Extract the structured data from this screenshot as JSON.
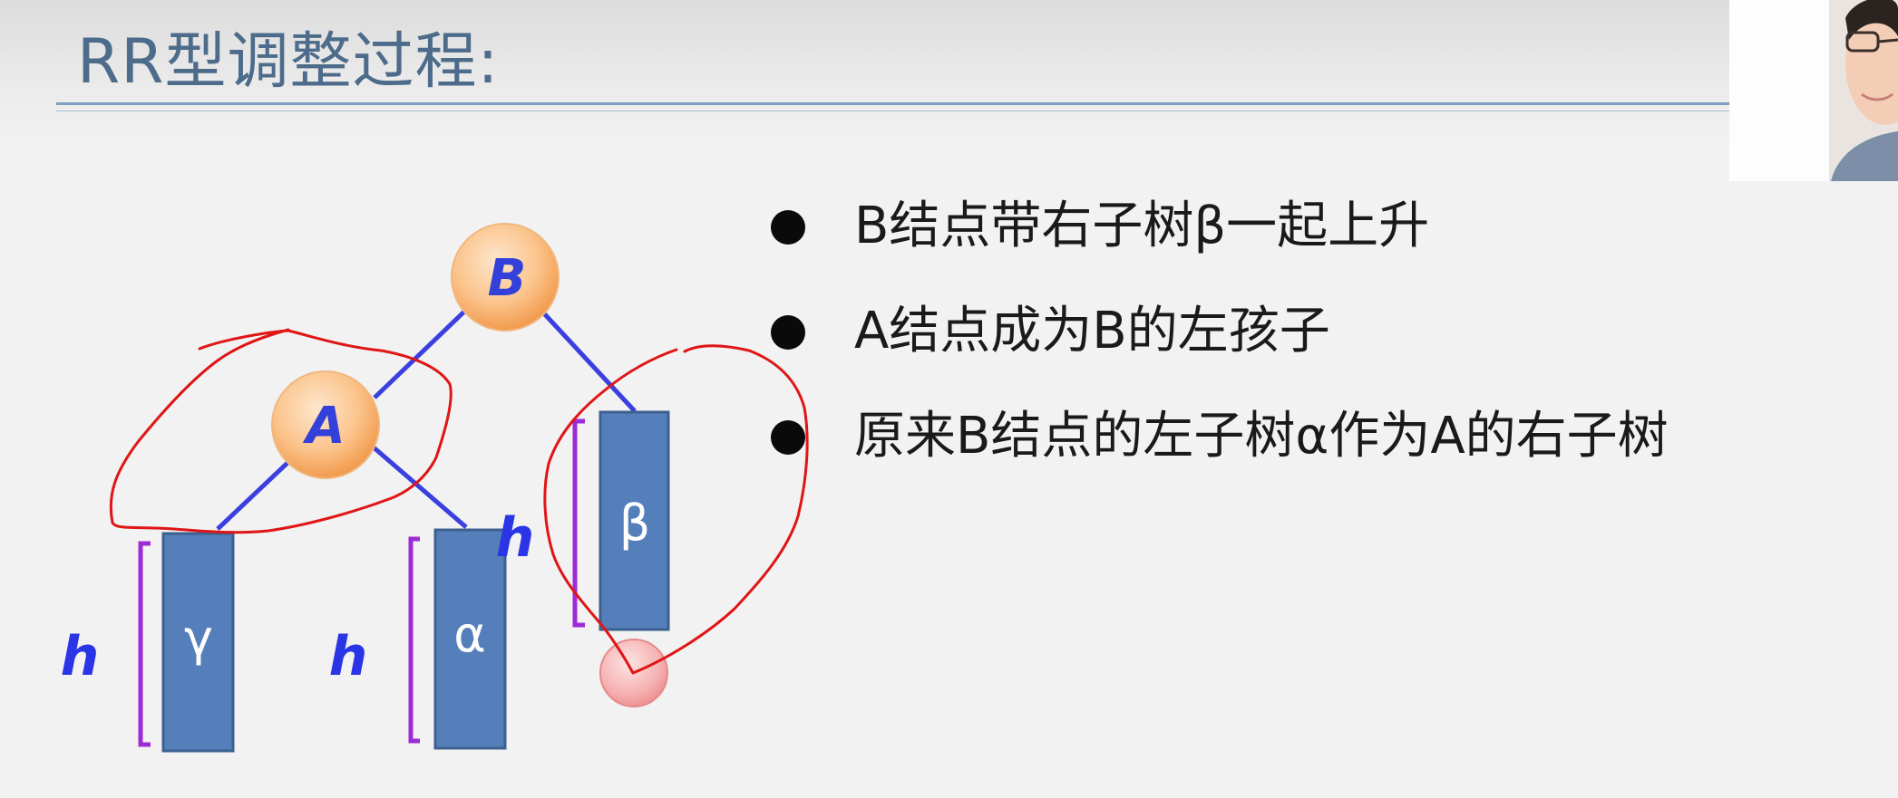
{
  "slide": {
    "title": "RR型调整过程:"
  },
  "bullets": [
    "B结点带右子树β一起上升",
    "A结点成为B的左孩子",
    "原来B结点的左子树α作为A的右子树"
  ],
  "diagram": {
    "nodes": {
      "root": "B",
      "child": "A"
    },
    "subtrees": {
      "left": "γ",
      "middle": "α",
      "right": "β"
    },
    "height_labels": {
      "left": "h",
      "middle": "h",
      "right": "h"
    }
  },
  "colors": {
    "title": "#4d6b8a",
    "node_fill_light": "#fde2c6",
    "node_fill_dark": "#f5a861",
    "node_label": "#3340d9",
    "edge": "#3a3fe0",
    "subtree_fill": "#557fba",
    "subtree_border": "#3c6090",
    "bracket": "#9f2bd6",
    "height_label": "#2a35e6",
    "annotation": "#e01515",
    "inserted_node": "#f4a9a9"
  }
}
